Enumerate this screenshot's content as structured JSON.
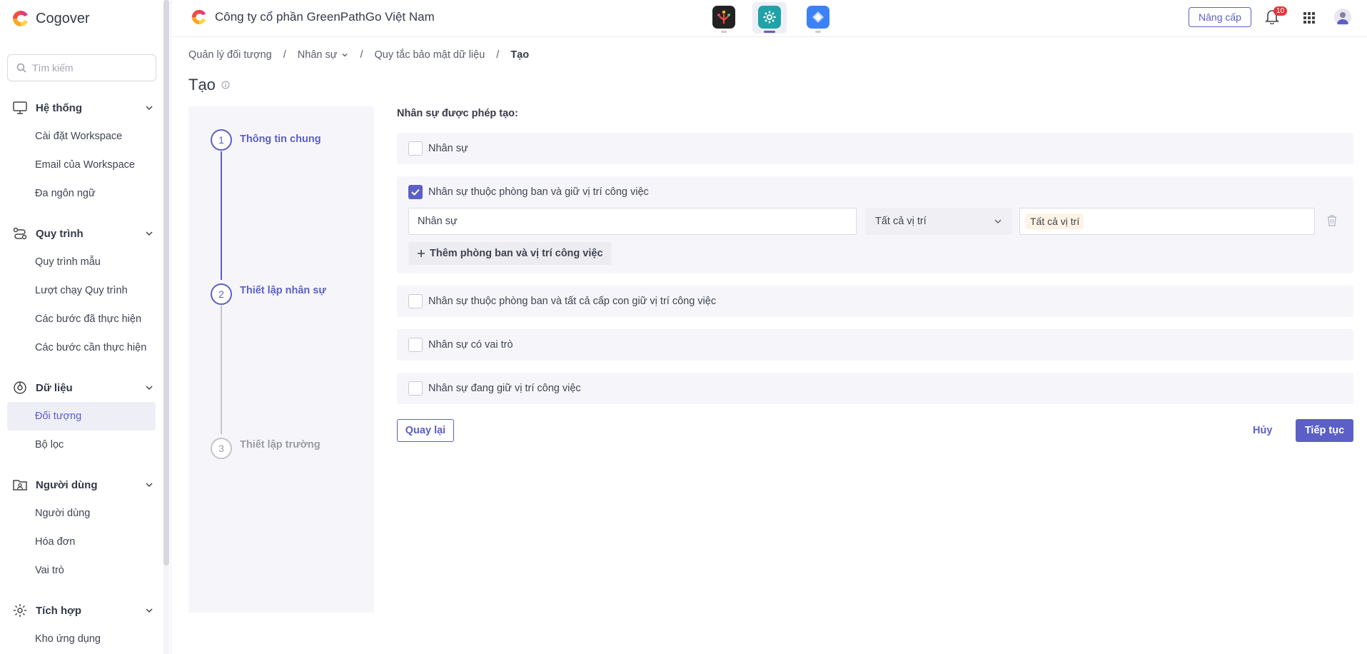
{
  "sidebar": {
    "brand": "Cogover",
    "search_placeholder": "Tìm kiếm",
    "groups": [
      {
        "label": "Hệ thống",
        "icon": "monitor-icon",
        "items": [
          "Cài đặt Workspace",
          "Email của Workspace",
          "Đa ngôn ngữ"
        ]
      },
      {
        "label": "Quy trình",
        "icon": "workflow-icon",
        "items": [
          "Quy trình mẫu",
          "Lượt chạy Quy trình",
          "Các bước đã thực hiện",
          "Các bước cần thực hiện"
        ]
      },
      {
        "label": "Dữ liệu",
        "icon": "data-icon",
        "items": [
          "Đối tượng",
          "Bộ lọc"
        ]
      },
      {
        "label": "Người dùng",
        "icon": "user-folder-icon",
        "items": [
          "Người dùng",
          "Hóa đơn",
          "Vai trò"
        ]
      },
      {
        "label": "Tích hợp",
        "icon": "integration-icon",
        "items": [
          "Kho ứng dụng"
        ]
      }
    ],
    "active_item": "Đối tượng"
  },
  "topbar": {
    "company": "Công ty cổ phần GreenPathGo Việt Nam",
    "apps": [
      "people-app-icon",
      "settings-app-icon",
      "diamond-app-icon"
    ],
    "active_app": "settings-app-icon",
    "upgrade_label": "Nâng cấp",
    "notification_count": "10"
  },
  "breadcrumb": {
    "items": [
      "Quản lý đối tượng",
      "Nhân sự",
      "Quy tắc bảo mật dữ liệu"
    ],
    "current": "Tạo",
    "separator": "/"
  },
  "page": {
    "title": "Tạo"
  },
  "steps": [
    {
      "number": "1",
      "label": "Thông tin chung",
      "state": "done"
    },
    {
      "number": "2",
      "label": "Thiết lập nhân sự",
      "state": "active"
    },
    {
      "number": "3",
      "label": "Thiết lập trường",
      "state": "pending"
    }
  ],
  "form": {
    "title": "Nhân sự được phép tạo:",
    "options": [
      {
        "label": "Nhân sự",
        "checked": false
      },
      {
        "label": "Nhân sự thuộc phòng ban và giữ vị trí công việc",
        "checked": true
      },
      {
        "label": "Nhân sự thuộc phòng ban và tất cả cấp con giữ vị trí công việc",
        "checked": false
      },
      {
        "label": "Nhân sự có vai trò",
        "checked": false
      },
      {
        "label": "Nhân sự đang giữ vị trí công việc",
        "checked": false
      }
    ],
    "department_value": "Nhân sự",
    "position_select": "Tất cả vị trí",
    "position_tag": "Tất cả vị trí",
    "add_label": "Thêm phòng ban và vị trí công việc"
  },
  "actions": {
    "back_label": "Quay lại",
    "cancel_label": "Hủy",
    "next_label": "Tiếp tục"
  },
  "colors": {
    "accent": "#5b5fc7",
    "panel": "#f6f6fa",
    "badge": "#e5353a"
  }
}
